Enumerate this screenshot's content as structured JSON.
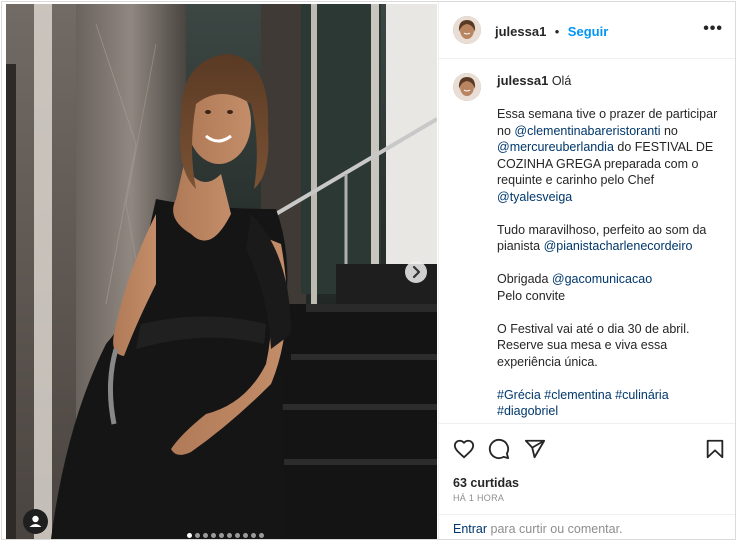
{
  "post": {
    "username": "julessa1",
    "follow_label": "Seguir",
    "separator": "•",
    "more_label": "•••"
  },
  "caption": {
    "username": "julessa1",
    "greeting": "Olá",
    "p1": [
      {
        "text": "Essa semana tive o prazer de participar no ",
        "type": "text"
      },
      {
        "text": "@clementinabareristoranti",
        "type": "mention"
      },
      {
        "text": " no ",
        "type": "text"
      },
      {
        "text": "@mercureuberlandia",
        "type": "mention"
      },
      {
        "text": " do FESTIVAL DE COZINHA GREGA preparada com o requinte e carinho pelo Chef ",
        "type": "text"
      },
      {
        "text": "@tyalesveiga",
        "type": "mention"
      }
    ],
    "p2": [
      {
        "text": "Tudo maravilhoso, perfeito ao som da pianista ",
        "type": "text"
      },
      {
        "text": "@pianistacharlenecordeiro",
        "type": "mention"
      }
    ],
    "p3_line1_prefix": "Obrigada ",
    "p3_mention": "@gacomunicacao",
    "p3_line2": "Pelo convite",
    "p4": "O Festival vai até o dia 30 de abril. Reserve sua mesa e viva essa experiência única.",
    "hashtags_line1": [
      "#Grécia",
      "#clementina",
      "#culinária"
    ],
    "hashtags_line2_partial": "#diagobriel"
  },
  "stats": {
    "likes": "63 curtidas",
    "time": "HÁ 1 HORA"
  },
  "comment": {
    "login_link": "Entrar",
    "rest": " para curtir ou comentar."
  },
  "carousel": {
    "total": 10,
    "active_index": 0
  },
  "icons": [
    "heart-icon",
    "comment-icon",
    "share-icon",
    "bookmark-icon",
    "chevron-right-icon",
    "user-tag-icon",
    "more-icon"
  ]
}
